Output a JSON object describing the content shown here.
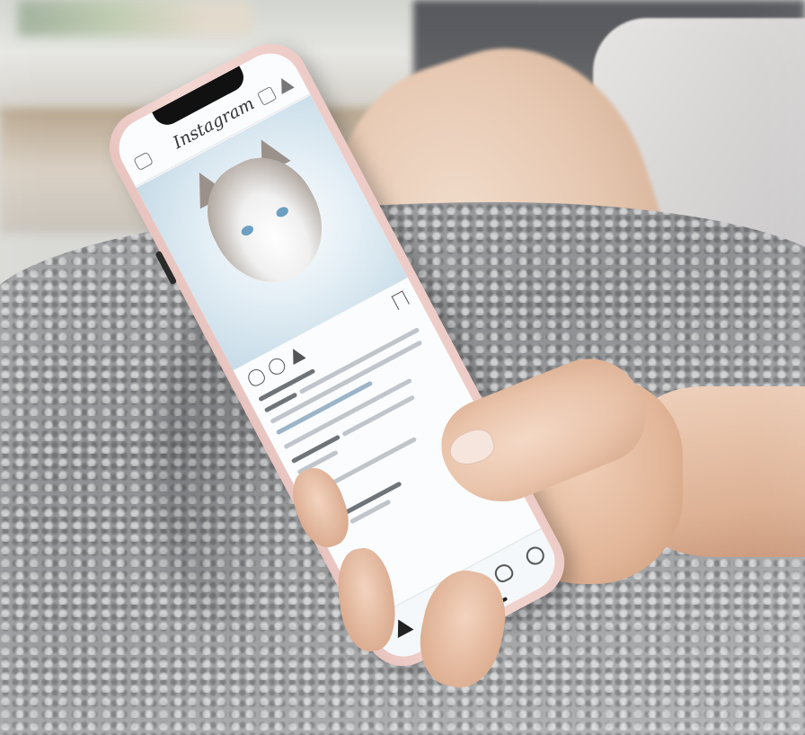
{
  "scene": {
    "description_kind": "photo",
    "palette": {
      "blanket": "#9ea0a2",
      "phone_case": "#f4d8d3",
      "skin": "#e9c3aa",
      "shorts": "#d8d6d5",
      "screen_photo_bg": "#c6dbe7"
    }
  },
  "phone_screen": {
    "app_logo_text": "Instagram",
    "icons": {
      "header_left": "camera-icon",
      "header_right": [
        "igtv-icon",
        "direct-message-icon"
      ],
      "post_actions": [
        "heart-icon",
        "comment-icon",
        "share-icon",
        "bookmark-icon"
      ],
      "tab_bar": [
        "home-icon",
        "search-icon",
        "add-post-icon",
        "activity-heart-icon",
        "profile-icon"
      ]
    }
  }
}
